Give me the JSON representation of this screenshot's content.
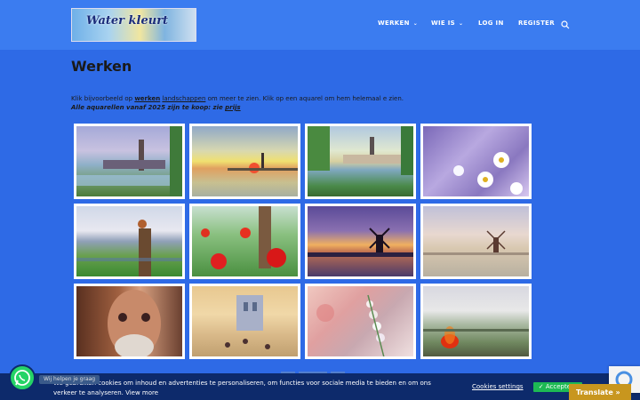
{
  "site": {
    "logo_text": "Water kleurt"
  },
  "nav": {
    "items": [
      {
        "label": "WERKEN",
        "dropdown": true
      },
      {
        "label": "WIE IS",
        "dropdown": true
      },
      {
        "label": "LOG IN",
        "dropdown": false
      },
      {
        "label": "REGISTER",
        "dropdown": false
      }
    ],
    "search_icon": "search-icon"
  },
  "page": {
    "title": "Werken",
    "intro_before": "Klik bijvoorbeeld op ",
    "intro_link1": "werken",
    "intro_link2": "landschappen",
    "intro_after": " om meer te zien. Klik op een aquarel om hem helemaal e zien.",
    "intro2_text": "Alle aquarellen vanaf 2025 zijn te koop: zie ",
    "intro2_link": "prijs"
  },
  "gallery": {
    "items": [
      {
        "subject": "riverside town with church tower"
      },
      {
        "subject": "sunset over water with tower"
      },
      {
        "subject": "town reflected in river"
      },
      {
        "subject": "daisies on purple"
      },
      {
        "subject": "bird on fence post"
      },
      {
        "subject": "poppies and fence post"
      },
      {
        "subject": "windmill at dusk"
      },
      {
        "subject": "windmill in pale landscape"
      },
      {
        "subject": "portrait of bearded man"
      },
      {
        "subject": "city street with tall building"
      },
      {
        "subject": "hollyhocks"
      },
      {
        "subject": "field with red glow"
      }
    ]
  },
  "cookie": {
    "text": "We gebruiken cookies om inhoud en advertenties te personaliseren, om functies voor sociale media te bieden en om ons verkeer te analyseren. View more",
    "settings_label": "Cookies settings",
    "accept_label": "✓ Accepteer"
  },
  "whatsapp": {
    "label": "Wij helpen je graag"
  },
  "translate": {
    "label": "Translate »"
  },
  "colors": {
    "background": "#2e6ae6",
    "header": "#3b7cf0",
    "cookie_bar": "#0d2a6b",
    "accept": "#1db954",
    "translate": "#c8961e"
  }
}
